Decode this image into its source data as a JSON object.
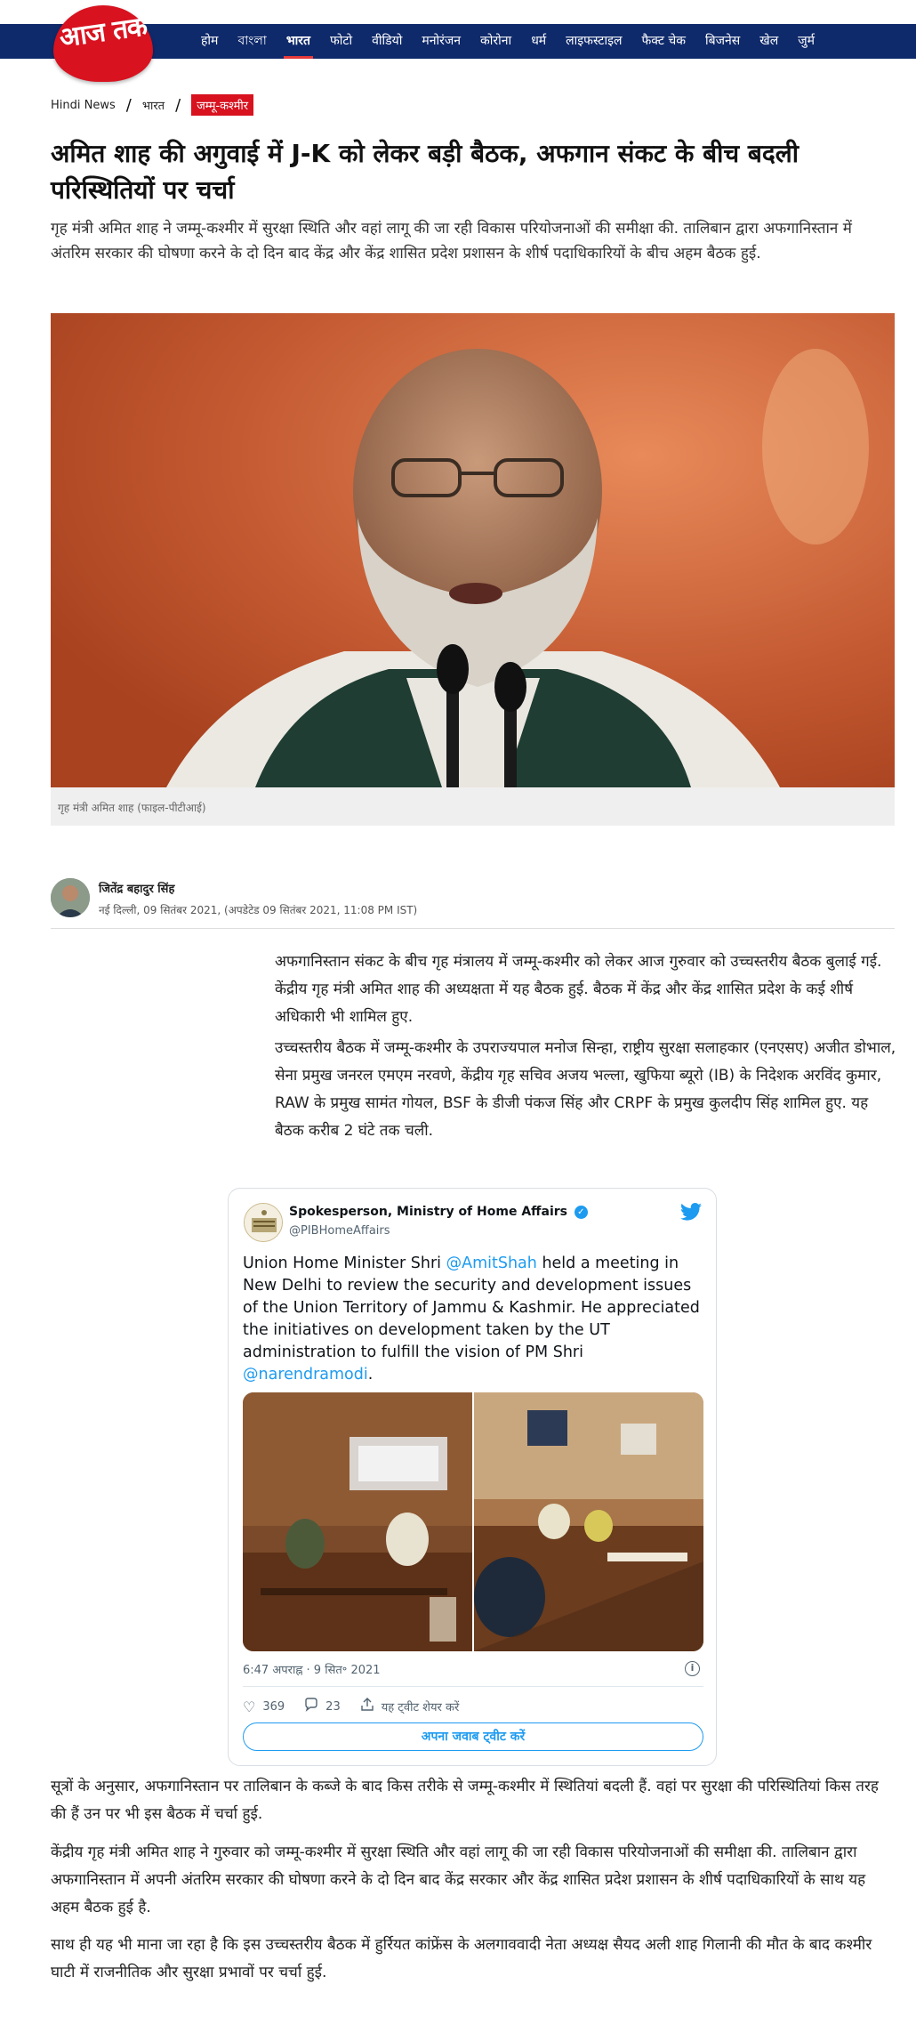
{
  "header": {
    "logo_text": "आज तक",
    "nav": [
      "होम",
      "বাংলা",
      "भारत",
      "फोटो",
      "वीडियो",
      "मनोरंजन",
      "कोरोना",
      "धर्म",
      "लाइफस्टाइल",
      "फैक्ट चेक",
      "बिजनेस",
      "खेल",
      "जुर्म"
    ],
    "active_nav": "भारत",
    "colors": {
      "nav_bg": "#0f2a6b",
      "brand_red": "#d8121f"
    }
  },
  "breadcrumb": {
    "home": "Hindi News",
    "section": "भारत",
    "tag": "जम्मू-कश्मीर"
  },
  "article": {
    "headline": "अमित शाह की अगुवाई में J-K को लेकर बड़ी बैठक, अफगान संकट के बीच बदली परिस्थितियों पर चर्चा",
    "subhead": "गृह मंत्री अमित शाह ने जम्मू-कश्मीर में सुरक्षा स्थिति और वहां लागू की जा रही विकास परियोजनाओं की समीक्षा की. तालिबान द्वारा अफगानिस्तान में अंतरिम सरकार की घोषणा करने के दो दिन बाद केंद्र और केंद्र शासित प्रदेश प्रशासन के शीर्ष पदाधिकारियों के बीच अहम बैठक हुई.",
    "image_caption": "गृह मंत्री अमित शाह (फाइल-पीटीआई)",
    "author": "जितेंद्र बहादुर सिंह",
    "dateline": "नई दिल्ली, 09 सितंबर 2021, (अपडेटेड 09 सितंबर 2021, 11:08 PM IST)",
    "para1": "अफगानिस्तान संकट के बीच गृह मंत्रालय में जम्मू-कश्मीर को लेकर आज गुरुवार को उच्चस्तरीय बैठक बुलाई गई. केंद्रीय गृह मंत्री अमित शाह की अध्यक्षता में यह बैठक हुई. बैठक में केंद्र और केंद्र शासित प्रदेश के कई शीर्ष अधिकारी भी शामिल हुए.",
    "para2": "उच्चस्तरीय बैठक में जम्मू-कश्मीर के उपराज्यपाल मनोज सिन्हा, राष्ट्रीय सुरक्षा सलाहकार (एनएसए) अजीत डोभाल, सेना प्रमुख जनरल एमएम नरवणे, केंद्रीय गृह सचिव अजय भल्ला, खुफिया ब्यूरो (IB) के निदेशक अरविंद कुमार, RAW के प्रमुख सामंत गोयल, BSF के डीजी पंकज सिंह और CRPF के प्रमुख कुलदीप सिंह शामिल हुए. यह बैठक करीब 2 घंटे तक चली.",
    "para3": "सूत्रों के अनुसार, अफगानिस्तान पर तालिबान के कब्जे के बाद किस तरीके से जम्मू-कश्मीर में स्थितियां बदली हैं. वहां पर सुरक्षा की परिस्थितियां किस तरह की हैं उन पर भी इस बैठक में चर्चा हुई.",
    "para4": "केंद्रीय गृह मंत्री अमित शाह ने गुरुवार को जम्मू-कश्मीर में सुरक्षा स्थिति और वहां लागू की जा रही विकास परियोजनाओं की समीक्षा की. तालिबान द्वारा अफगानिस्तान में अपनी अंतरिम सरकार की घोषणा करने के दो दिन बाद केंद्र सरकार और केंद्र शासित प्रदेश प्रशासन के शीर्ष पदाधिकारियों के साथ यह अहम बैठक हुई है.",
    "para5": "साथ ही यह भी माना जा रहा है कि इस उच्चस्तरीय बैठक में हुर्रियत कांफ्रेंस के अलगाववादी नेता अध्यक्ष सैयद अली शाह गिलानी की मौत के बाद कश्मीर घाटी में राजनीतिक और सुरक्षा प्रभावों पर चर्चा हुई."
  },
  "tweet": {
    "name": "Spokesperson, Ministry of Home Affairs",
    "handle": "@PIBHomeAffairs",
    "text_1": "Union Home Minister Shri ",
    "mention_1": "@AmitShah",
    "text_2": " held a meeting in New Delhi to review the security and development issues of the Union Territory of Jammu & Kashmir. He appreciated the initiatives on development taken by the UT administration to fulfill the vision of PM Shri ",
    "mention_2": "@narendramodi",
    "text_3": ".",
    "timestamp": "6:47 अपराह्न · 9 सित॰ 2021",
    "likes": "369",
    "replies": "23",
    "share_label": "यह ट्वीट शेयर करें",
    "reply_button": "अपना जवाब ट्वीट करें",
    "info": "i",
    "colors": {
      "link": "#1d9bf0"
    }
  }
}
